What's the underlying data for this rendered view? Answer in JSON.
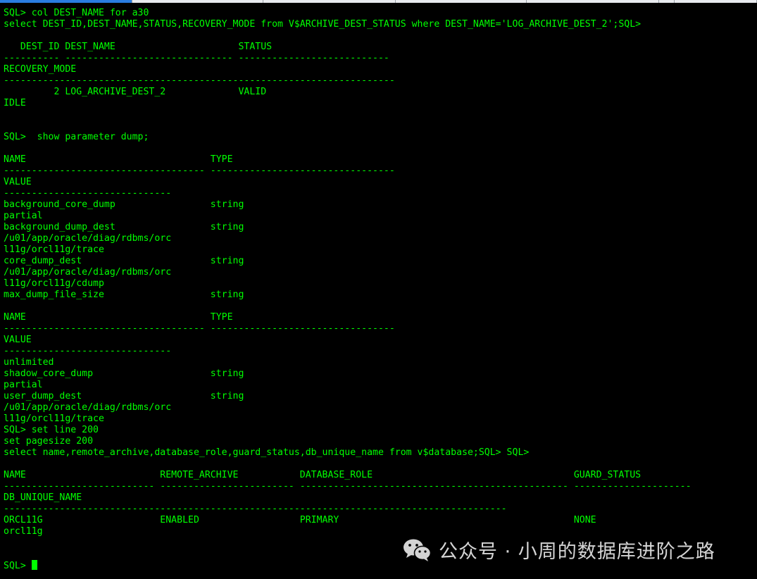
{
  "terminal": {
    "lines": [
      "SQL> col DEST_NAME for a30",
      "select DEST_ID,DEST_NAME,STATUS,RECOVERY_MODE from V$ARCHIVE_DEST_STATUS where DEST_NAME='LOG_ARCHIVE_DEST_2';SQL>",
      "",
      "   DEST_ID DEST_NAME                      STATUS",
      "---------- ------------------------------ ---------------------------",
      "RECOVERY_MODE",
      "----------------------------------------------------------------------",
      "         2 LOG_ARCHIVE_DEST_2             VALID",
      "IDLE",
      "",
      "",
      "SQL>  show parameter dump;",
      "",
      "NAME                                 TYPE",
      "------------------------------------ ---------------------------------",
      "VALUE",
      "------------------------------",
      "background_core_dump                 string",
      "partial",
      "background_dump_dest                 string",
      "/u01/app/oracle/diag/rdbms/orc",
      "l11g/orcl11g/trace",
      "core_dump_dest                       string",
      "/u01/app/oracle/diag/rdbms/orc",
      "l11g/orcl11g/cdump",
      "max_dump_file_size                   string",
      "",
      "NAME                                 TYPE",
      "------------------------------------ ---------------------------------",
      "VALUE",
      "------------------------------",
      "unlimited",
      "shadow_core_dump                     string",
      "partial",
      "user_dump_dest                       string",
      "/u01/app/oracle/diag/rdbms/orc",
      "l11g/orcl11g/trace",
      "SQL> set line 200",
      "set pagesize 200",
      "select name,remote_archive,database_role,guard_status,db_unique_name from v$database;SQL> SQL>",
      "",
      "NAME                        REMOTE_ARCHIVE           DATABASE_ROLE                                    GUARD_STATUS",
      "--------------------------- ------------------------ ------------------------------------------------ ---------------------",
      "DB_UNIQUE_NAME",
      "------------------------------------------------------------------------------------------",
      "ORCL11G                     ENABLED                  PRIMARY                                          NONE",
      "orcl11g",
      "",
      ""
    ],
    "prompt": "SQL> "
  },
  "watermark": {
    "icon": "wechat-icon",
    "text": "公众号 · 小周的数据库进阶之路"
  },
  "colors": {
    "background": "#000000",
    "text": "#00ff00",
    "cursor": "#00ff00",
    "tab_active": "#2a7de1"
  }
}
